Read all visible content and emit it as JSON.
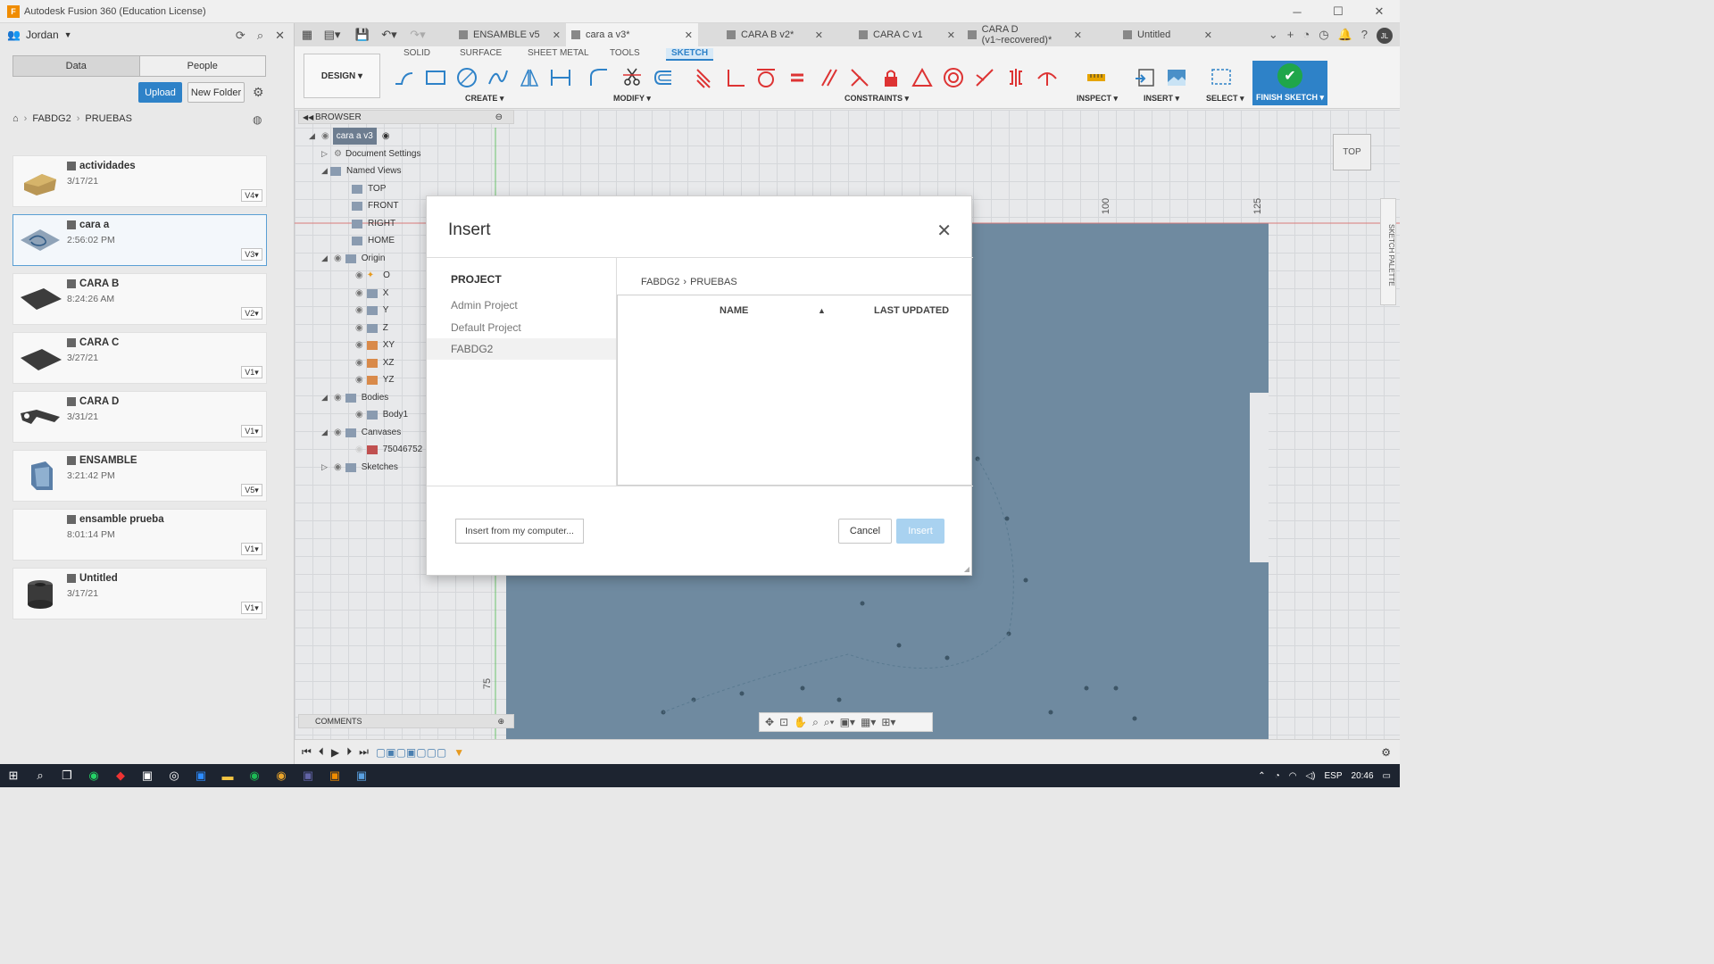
{
  "window": {
    "title": "Autodesk Fusion 360 (Education License)",
    "logo": "F"
  },
  "datapanel": {
    "user": "Jordan",
    "tabs": [
      "Data",
      "People"
    ],
    "upload_label": "Upload",
    "new_folder_label": "New Folder",
    "breadcrumb": [
      "FABDG2",
      "PRUEBAS"
    ],
    "files": [
      {
        "name": "actividades",
        "date": "3/17/21",
        "version": "V4"
      },
      {
        "name": "cara a",
        "date": "2:56:02 PM",
        "version": "V3"
      },
      {
        "name": "CARA B",
        "date": "8:24:26 AM",
        "version": "V2"
      },
      {
        "name": "CARA C",
        "date": "3/27/21",
        "version": "V1"
      },
      {
        "name": "CARA D",
        "date": "3/31/21",
        "version": "V1"
      },
      {
        "name": "ENSAMBLE",
        "date": "3:21:42 PM",
        "version": "V5"
      },
      {
        "name": "ensamble prueba",
        "date": "8:01:14 PM",
        "version": "V1"
      },
      {
        "name": "Untitled",
        "date": "3/17/21",
        "version": "V1"
      }
    ]
  },
  "doc_tabs": [
    {
      "label": "ENSAMBLE v5"
    },
    {
      "label": "cara a v3*"
    },
    {
      "label": "CARA B v2*"
    },
    {
      "label": "CARA C v1"
    },
    {
      "label": "CARA D (v1~recovered)*"
    },
    {
      "label": "Untitled"
    }
  ],
  "user_initials": "JL",
  "toolbar": {
    "workspace": "DESIGN ▾",
    "tabs": [
      "SOLID",
      "SURFACE",
      "SHEET METAL",
      "TOOLS",
      "SKETCH"
    ],
    "groups": [
      "CREATE ▾",
      "MODIFY ▾",
      "CONSTRAINTS ▾",
      "INSPECT ▾",
      "INSERT ▾",
      "SELECT ▾"
    ],
    "finish": "FINISH SKETCH ▾"
  },
  "browser": {
    "title": "BROWSER",
    "doc": "cara a v3",
    "items": [
      "Document Settings",
      "Named Views",
      "TOP",
      "FRONT",
      "RIGHT",
      "HOME",
      "Origin",
      "O",
      "X",
      "Y",
      "Z",
      "XY",
      "XZ",
      "YZ",
      "Bodies",
      "Body1",
      "Canvases",
      "75046752",
      "Sketches"
    ]
  },
  "comments_label": "COMMENTS",
  "viewcube_label": "TOP",
  "sketch_palette_label": "SKETCH PALETTE",
  "ruler": {
    "r100": "100",
    "r125": "125",
    "r75": "75"
  },
  "modal": {
    "title": "Insert",
    "project_header": "PROJECT",
    "projects": [
      "Admin Project",
      "Default Project",
      "FABDG2"
    ],
    "breadcrumb": [
      "FABDG2",
      "PRUEBAS"
    ],
    "col_name": "NAME",
    "col_updated": "LAST UPDATED",
    "from_computer": "Insert from my computer...",
    "cancel": "Cancel",
    "insert": "Insert"
  },
  "taskbar": {
    "lang": "ESP",
    "time": "20:46"
  }
}
